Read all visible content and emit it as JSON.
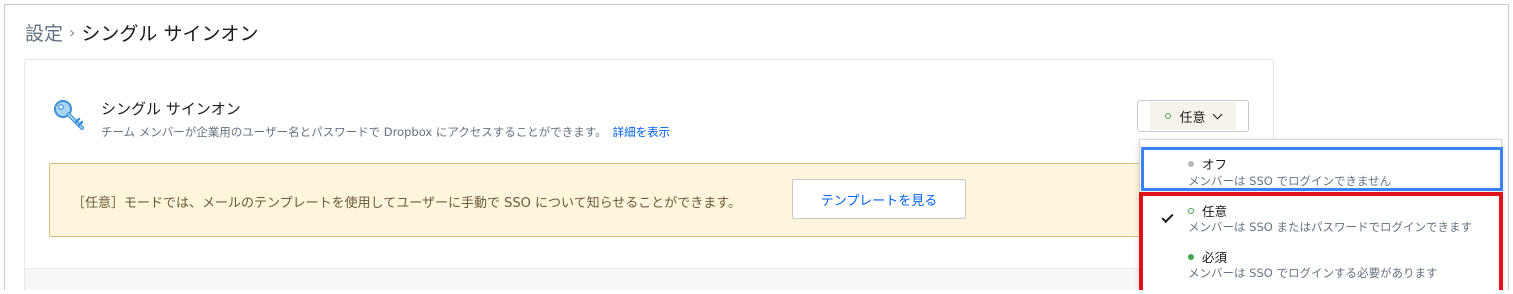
{
  "breadcrumb": {
    "root": "設定",
    "separator": "›",
    "current": "シングル サインオン"
  },
  "sso": {
    "icon": "key-icon",
    "title": "シングル サインオン",
    "description": "チーム メンバーが企業用のユーザー名とパスワードで Dropbox にアクセスすることができます。",
    "details_link": "詳細を表示"
  },
  "mode_select": {
    "selected_label": "任意",
    "status_icon": "dot-outline-green-icon",
    "chevron": "chevron-down-icon"
  },
  "notice": {
    "text": "［任意］モードでは、メールのテンプレートを使用してユーザーに手動で SSO について知らせることができます。",
    "button_label": "テンプレートを見る"
  },
  "dropdown": {
    "options": [
      {
        "label": "オフ",
        "description": "メンバーは SSO でログインできません",
        "dot": "gray",
        "checked": false
      },
      {
        "label": "任意",
        "description": "メンバーは SSO またはパスワードでログインできます",
        "dot": "green-outline",
        "checked": true
      },
      {
        "label": "必須",
        "description": "メンバーは SSO でログインする必要があります",
        "dot": "green",
        "checked": false
      }
    ]
  },
  "colors": {
    "accent": "#0061fe",
    "notice_bg": "#fdf6dc",
    "highlight_blue": "#3b82f6",
    "highlight_red": "#e0101a",
    "status_green": "#3fa84a"
  }
}
